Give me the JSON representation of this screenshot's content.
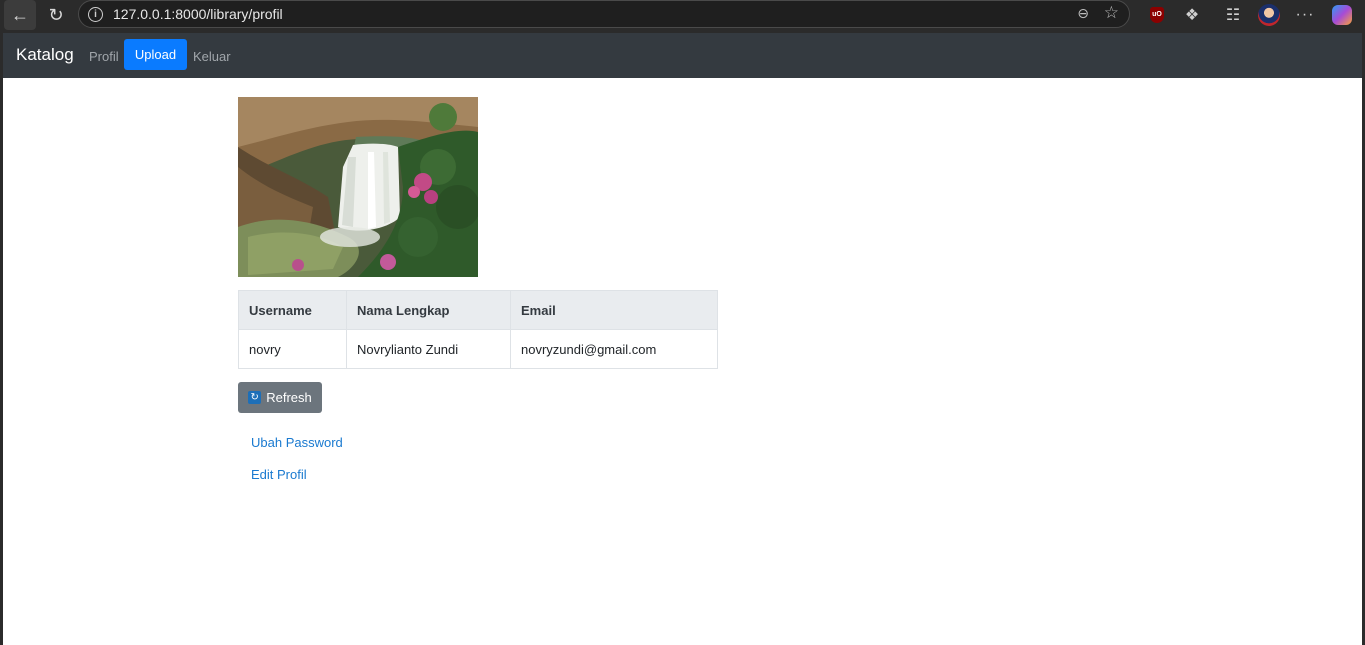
{
  "browser": {
    "url": "127.0.0.1:8000/library/profil",
    "back_glyph": "←",
    "reload_glyph": "↻",
    "info_glyph": "i",
    "zoom_glyph": "⊖",
    "star_glyph": "☆",
    "puzzle_glyph": "❖",
    "favorites_glyph": "☷",
    "more_glyph": "···",
    "ublock_glyph": "uO"
  },
  "navbar": {
    "brand": "Katalog",
    "links": [
      "Profil",
      "Upload",
      "Keluar"
    ],
    "active": "Upload"
  },
  "profile_table": {
    "headers": [
      "Username",
      "Nama Lengkap",
      "Email"
    ],
    "row": [
      "novry",
      "Novrylianto Zundi",
      "novryzundi@gmail.com"
    ]
  },
  "actions": {
    "refresh_label": "Refresh",
    "refresh_glyph": "↻",
    "change_password_label": "Ubah Password",
    "edit_profile_label": "Edit Profil"
  },
  "colors": {
    "navbar_bg": "#343a40",
    "active_nav_bg": "#0a7bff",
    "secondary_button": "#6c757d",
    "link": "#1a7ad0"
  }
}
